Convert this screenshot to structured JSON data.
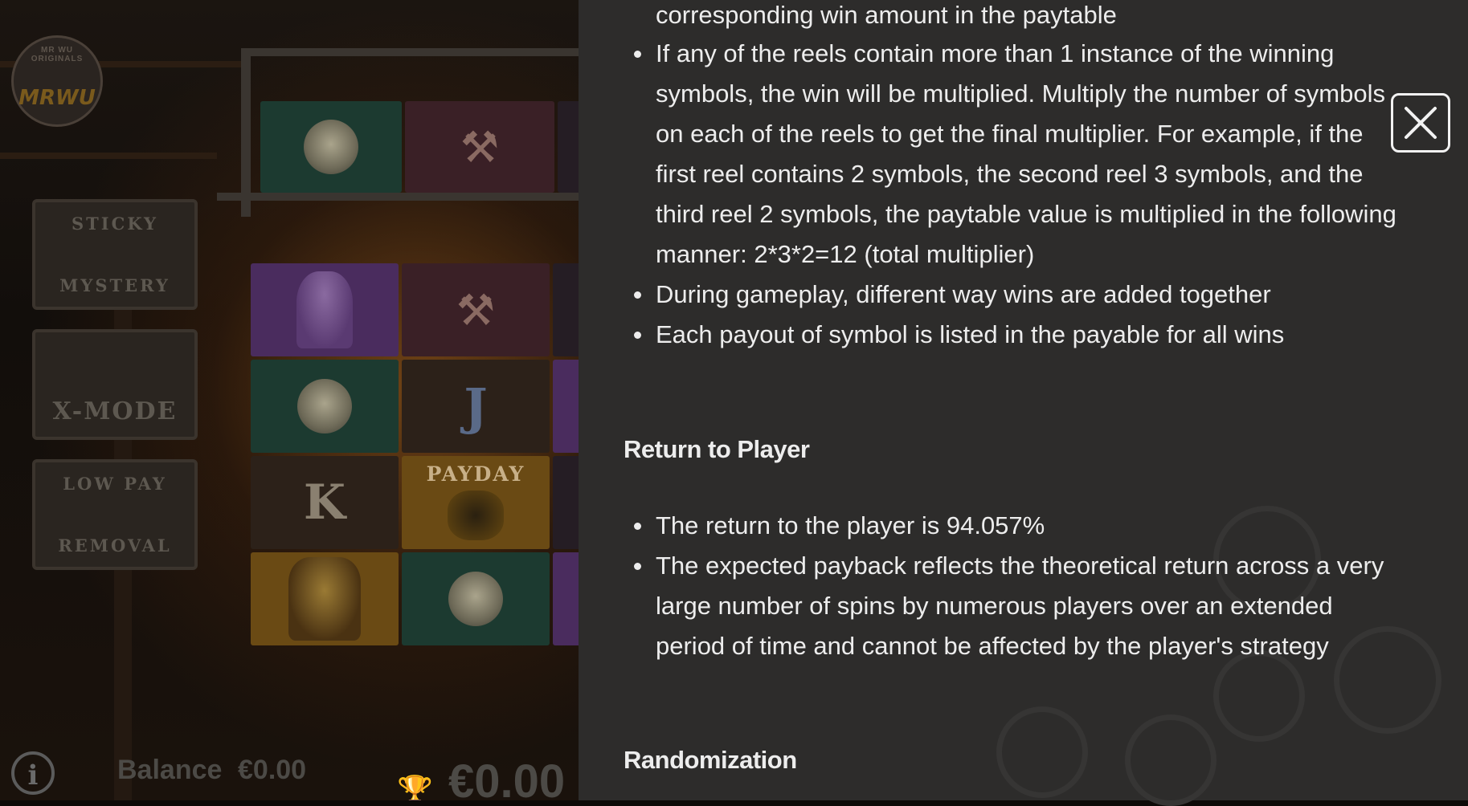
{
  "game": {
    "logo_text": "MRWU",
    "logo_arc": "MR WU ORIGINALS",
    "feature_signs": {
      "sticky_mystery": [
        "STICKY",
        "MYSTERY"
      ],
      "x_mode": "X-MODE",
      "low_pay_removal": [
        "LOW PAY",
        "REMOVAL"
      ]
    },
    "reel_symbols": {
      "payday": "PAYDAY",
      "k": "K",
      "j": "J"
    },
    "bottom_bar": {
      "info_icon": "i",
      "balance_label": "Balance",
      "balance_value": "€0.00",
      "win_value": "€0.00"
    }
  },
  "info": {
    "continued_line": "corresponding win amount in the paytable",
    "ways_bullets": [
      "If any of the reels contain more than 1 instance of the winning symbols, the win will be multiplied. Multiply the number of symbols on each of the reels to get the final multiplier. For example, if the first reel contains 2 symbols, the second reel 3 symbols, and the third reel 2 symbols, the paytable value is multiplied in the following manner: 2*3*2=12 (total multiplier)",
      "During gameplay, different way wins are added together",
      "Each payout of symbol is listed in the payable for all wins"
    ],
    "rtp_heading": "Return to Player",
    "rtp_bullets": [
      "The return to the player is 94.057%",
      "The expected payback reflects the theoretical return across a very large number of spins by numerous players over an extended period of time and cannot be affected by the player's strategy"
    ],
    "randomization_heading": "Randomization"
  },
  "icons": {
    "close": "close-icon",
    "info": "info-icon",
    "trophy": "trophy-icon"
  }
}
